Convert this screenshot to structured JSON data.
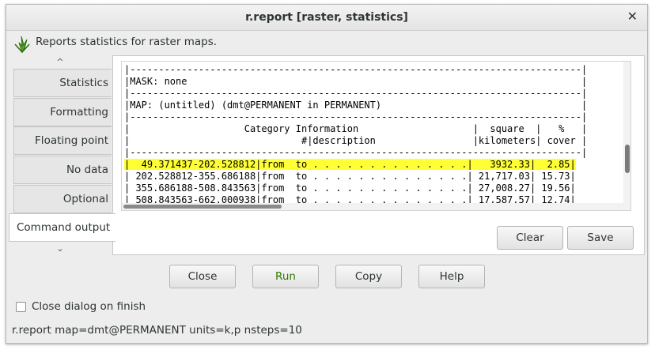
{
  "window": {
    "title": "r.report [raster, statistics]"
  },
  "description": "Reports statistics for raster maps.",
  "tabs": [
    {
      "label": "Statistics"
    },
    {
      "label": "Formatting"
    },
    {
      "label": "Floating point"
    },
    {
      "label": "No data"
    },
    {
      "label": "Optional"
    },
    {
      "label": "Command output"
    }
  ],
  "active_tab": "Command output",
  "output": {
    "lines": [
      "|-------------------------------------------------------------------------------|",
      "|MASK: none                                                                     |",
      "|-------------------------------------------------------------------------------|",
      "|MAP: (untitled) (dmt@PERMANENT in PERMANENT)                                   |",
      "|-------------------------------------------------------------------------------|",
      "|                    Category Information                    |  square  |   %   |",
      "|                              #|description                 |kilometers| cover |",
      "|-------------------------------------------------------------------------------|"
    ],
    "highlighted": "|  49.371437-202.528812|from  to . . . . . . . . . . . . . .|   3932.33|  2.85|",
    "rows": [
      "| 202.528812-355.686188|from  to . . . . . . . . . . . . . .| 21,717.03| 15.73|",
      "| 355.686188-508.843563|from  to . . . . . . . . . . . . . .| 27,008.27| 19.56|",
      "| 508.843563-662.000938|from  to . . . . . . . . . . . . . .| 17,587.57| 12.74|"
    ]
  },
  "buttons": {
    "clear": "Clear",
    "save": "Save",
    "close": "Close",
    "run": "Run",
    "copy": "Copy",
    "help": "Help"
  },
  "close_on_finish": {
    "label": "Close dialog on finish",
    "checked": false
  },
  "command": "r.report map=dmt@PERMANENT units=k,p nsteps=10",
  "colors": {
    "highlight": "#ffff33",
    "run_text": "#2f7a00"
  }
}
